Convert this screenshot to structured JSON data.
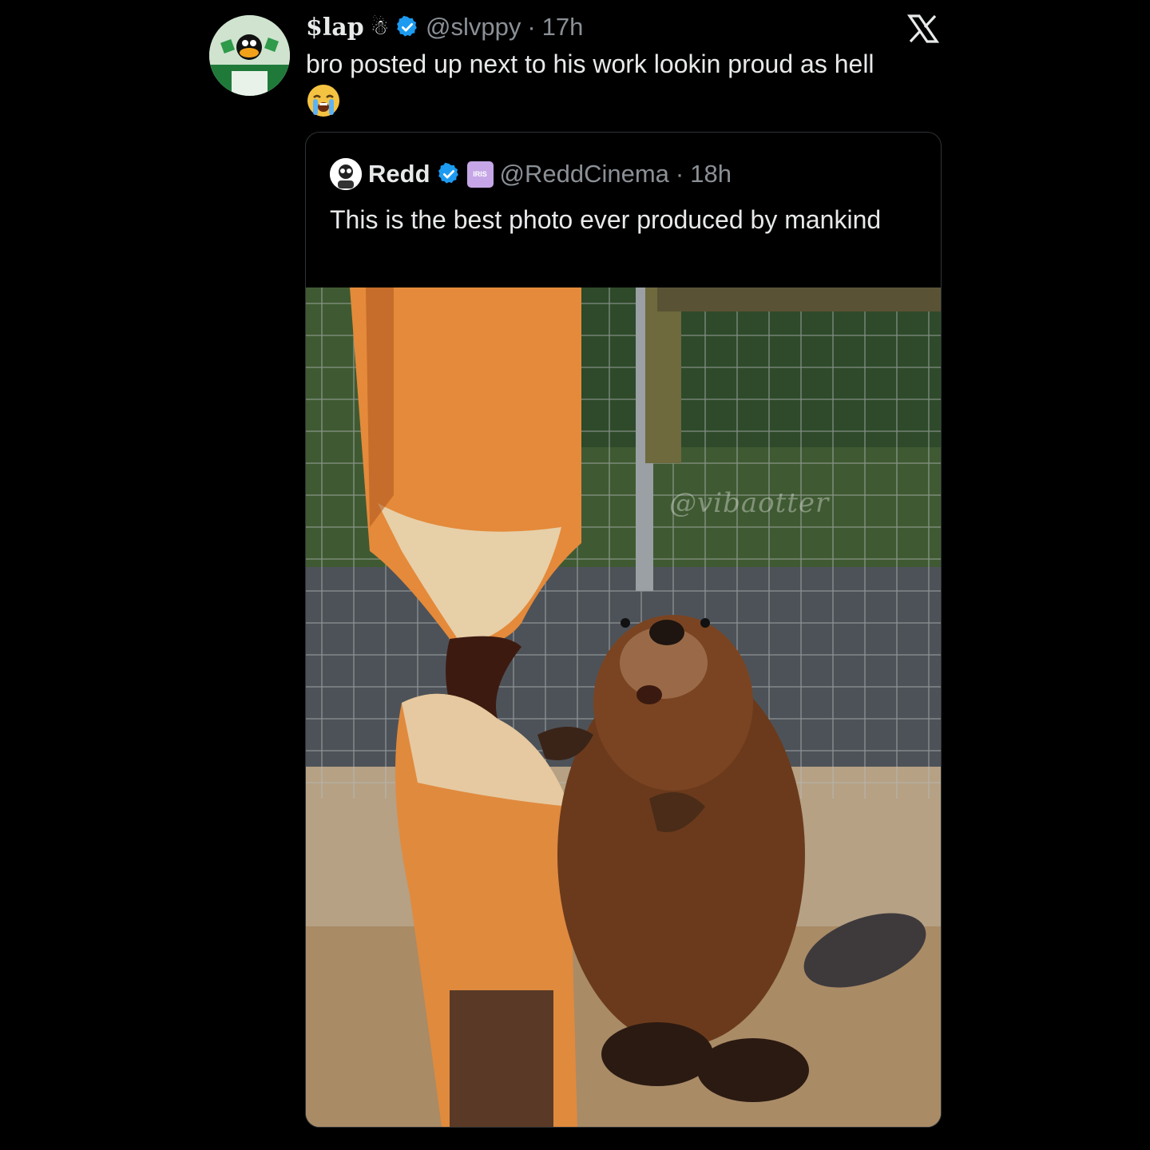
{
  "tweet": {
    "display_name": "$lap",
    "name_emoji": "☃",
    "handle": "@slvppy",
    "separator": "·",
    "time": "17h",
    "text": "bro posted up next to his work lookin proud as hell",
    "verified_color": "#1d9bf0"
  },
  "quoted_tweet": {
    "display_name": "Redd",
    "badge_text": "IRIS",
    "handle": "@ReddCinema",
    "separator": "·",
    "time": "18h",
    "text": "This is the best photo ever produced by mankind",
    "photo_watermark": "@vibaotter"
  },
  "icons": {
    "platform_logo": "x-logo-icon",
    "verified": "verified-badge-icon",
    "emoji": "loudly-crying-face-icon"
  }
}
